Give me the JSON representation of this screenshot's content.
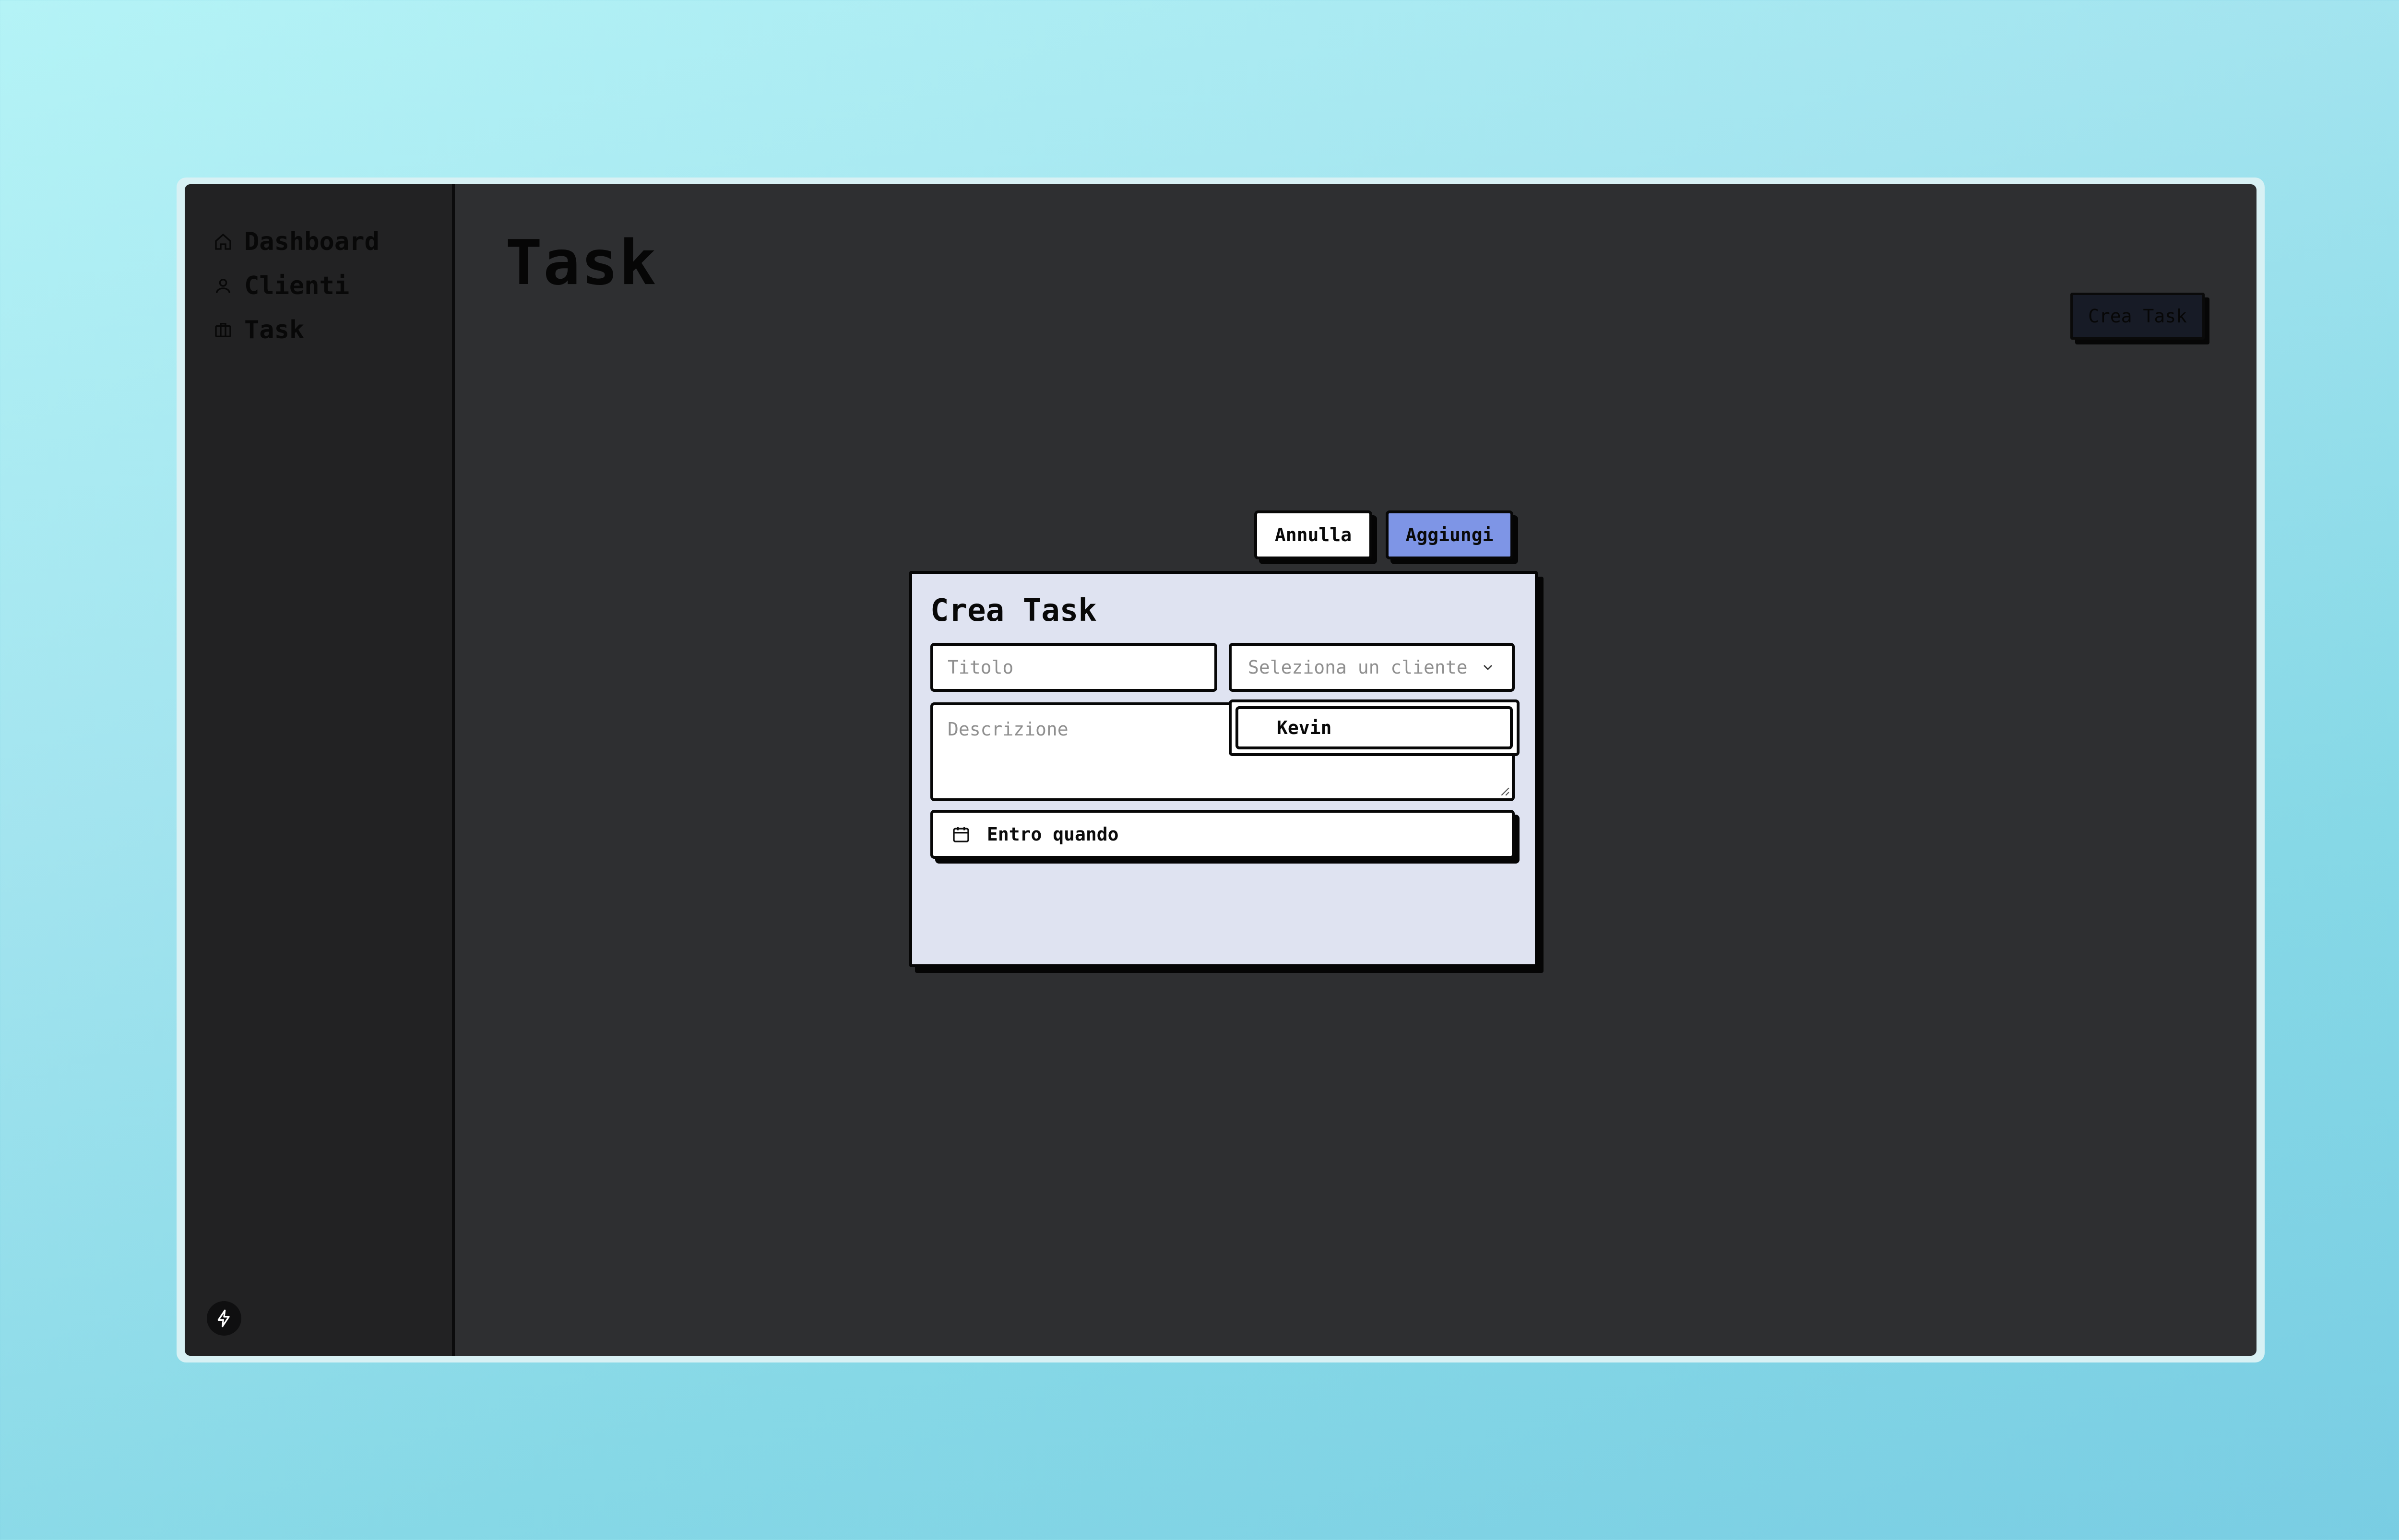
{
  "sidebar": {
    "items": [
      {
        "label": "Dashboard",
        "icon": "home-icon"
      },
      {
        "label": "Clienti",
        "icon": "user-icon"
      },
      {
        "label": "Task",
        "icon": "briefcase-icon"
      }
    ],
    "footer_icon": "lightning-icon"
  },
  "main": {
    "title": "Task",
    "create_button_label": "Crea Task"
  },
  "dialog": {
    "title": "Crea Task",
    "title_placeholder": "Titolo",
    "client_select_placeholder": "Seleziona un cliente",
    "client_options": [
      "Kevin"
    ],
    "description_placeholder": "Descrizione",
    "date_label": "Entro quando",
    "cancel_label": "Annulla",
    "add_label": "Aggiungi"
  },
  "colors": {
    "add_button": "#7e95e6",
    "dialog_background": "#dfe3f1",
    "app_background": "#2e2f31"
  }
}
